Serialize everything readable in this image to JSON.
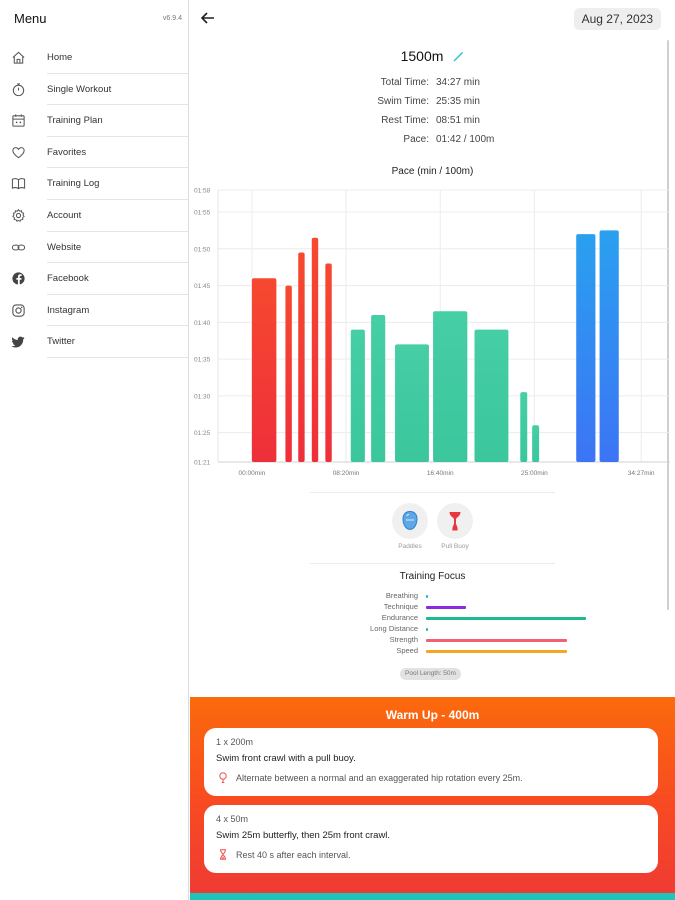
{
  "sidebar": {
    "title": "Menu",
    "version": "v6.9.4",
    "items": [
      {
        "label": "Home",
        "icon": "home-icon"
      },
      {
        "label": "Single Workout",
        "icon": "stopwatch-icon"
      },
      {
        "label": "Training Plan",
        "icon": "calendar-icon"
      },
      {
        "label": "Favorites",
        "icon": "heart-icon"
      },
      {
        "label": "Training Log",
        "icon": "book-icon"
      },
      {
        "label": "Account",
        "icon": "gear-icon"
      },
      {
        "label": "Website",
        "icon": "link-icon"
      },
      {
        "label": "Facebook",
        "icon": "facebook-icon"
      },
      {
        "label": "Instagram",
        "icon": "instagram-icon"
      },
      {
        "label": "Twitter",
        "icon": "twitter-icon"
      }
    ]
  },
  "header": {
    "date": "Aug 27, 2023"
  },
  "workout": {
    "distance": "1500m",
    "stats": [
      {
        "label": "Total Time:",
        "value": "34:27 min"
      },
      {
        "label": "Swim Time:",
        "value": "25:35 min"
      },
      {
        "label": "Rest Time:",
        "value": "08:51 min"
      },
      {
        "label": "Pace:",
        "value": "01:42 / 100m"
      }
    ]
  },
  "chart_data": {
    "type": "bar",
    "title": "Pace (min / 100m)",
    "y_ticks": [
      "01:58",
      "01:55",
      "01:50",
      "01:45",
      "01:40",
      "01:35",
      "01:30",
      "01:25",
      "01:21"
    ],
    "ylim_seconds": [
      81,
      118
    ],
    "x_ticks": [
      "00:00min",
      "08:20min",
      "16:40min",
      "25:00min",
      "34:27min"
    ],
    "x_tick_seconds": [
      0,
      500,
      1000,
      1500,
      2067
    ],
    "xlim_seconds": [
      -180,
      2220
    ],
    "grid": true,
    "bars": [
      {
        "start": 0,
        "end": 130,
        "pace_seconds": 106,
        "color": "red"
      },
      {
        "start": 178,
        "end": 212,
        "pace_seconds": 105,
        "color": "red"
      },
      {
        "start": 246,
        "end": 280,
        "pace_seconds": 109.5,
        "color": "red"
      },
      {
        "start": 318,
        "end": 352,
        "pace_seconds": 111.5,
        "color": "red"
      },
      {
        "start": 390,
        "end": 424,
        "pace_seconds": 108,
        "color": "red"
      },
      {
        "start": 525,
        "end": 600,
        "pace_seconds": 99,
        "color": "green"
      },
      {
        "start": 633,
        "end": 708,
        "pace_seconds": 101,
        "color": "green"
      },
      {
        "start": 760,
        "end": 940,
        "pace_seconds": 97,
        "color": "green"
      },
      {
        "start": 962,
        "end": 1144,
        "pace_seconds": 101.5,
        "color": "green"
      },
      {
        "start": 1182,
        "end": 1362,
        "pace_seconds": 99,
        "color": "green"
      },
      {
        "start": 1425,
        "end": 1462,
        "pace_seconds": 90.5,
        "color": "green"
      },
      {
        "start": 1488,
        "end": 1525,
        "pace_seconds": 86,
        "color": "green"
      },
      {
        "start": 1722,
        "end": 1824,
        "pace_seconds": 112,
        "color": "blue"
      },
      {
        "start": 1846,
        "end": 1948,
        "pace_seconds": 112.5,
        "color": "blue"
      }
    ],
    "series_colors": {
      "red": "#f43b2e",
      "green": "#3fcaa0",
      "blue": "#2f8df3"
    }
  },
  "equipment": [
    {
      "label": "Paddles",
      "icon": "paddles-icon"
    },
    {
      "label": "Pull Buoy",
      "icon": "pull-buoy-icon"
    }
  ],
  "focus": {
    "title": "Training Focus",
    "items": [
      {
        "label": "Breathing",
        "value": 0.01,
        "color": "#29a7e0"
      },
      {
        "label": "Technique",
        "value": 0.25,
        "color": "#8a2be2"
      },
      {
        "label": "Endurance",
        "value": 1.0,
        "color": "#1fb98f"
      },
      {
        "label": "Long Distance",
        "value": 0.01,
        "color": "#1fb98f"
      },
      {
        "label": "Strength",
        "value": 0.88,
        "color": "#f06174"
      },
      {
        "label": "Speed",
        "value": 0.88,
        "color": "#f5a623"
      }
    ]
  },
  "pool_length": "Pool Length: 50m",
  "section": {
    "title": "Warm Up - 400m",
    "cards": [
      {
        "set": "1 x 200m",
        "desc": "Swim front crawl with a pull buoy.",
        "tip": "Alternate between a normal and an exaggerated hip rotation every 25m.",
        "tip_icon": "lightbulb-icon"
      },
      {
        "set": "4 x 50m",
        "desc": "Swim 25m butterfly, then 25m front crawl.",
        "tip": "Rest 40 s after each interval.",
        "tip_icon": "hourglass-icon"
      }
    ]
  },
  "colors": {
    "warmup_gradient_top": "#fb6a0c",
    "warmup_gradient_bottom": "#ef3b33",
    "next_section": "#1fc5b8"
  }
}
